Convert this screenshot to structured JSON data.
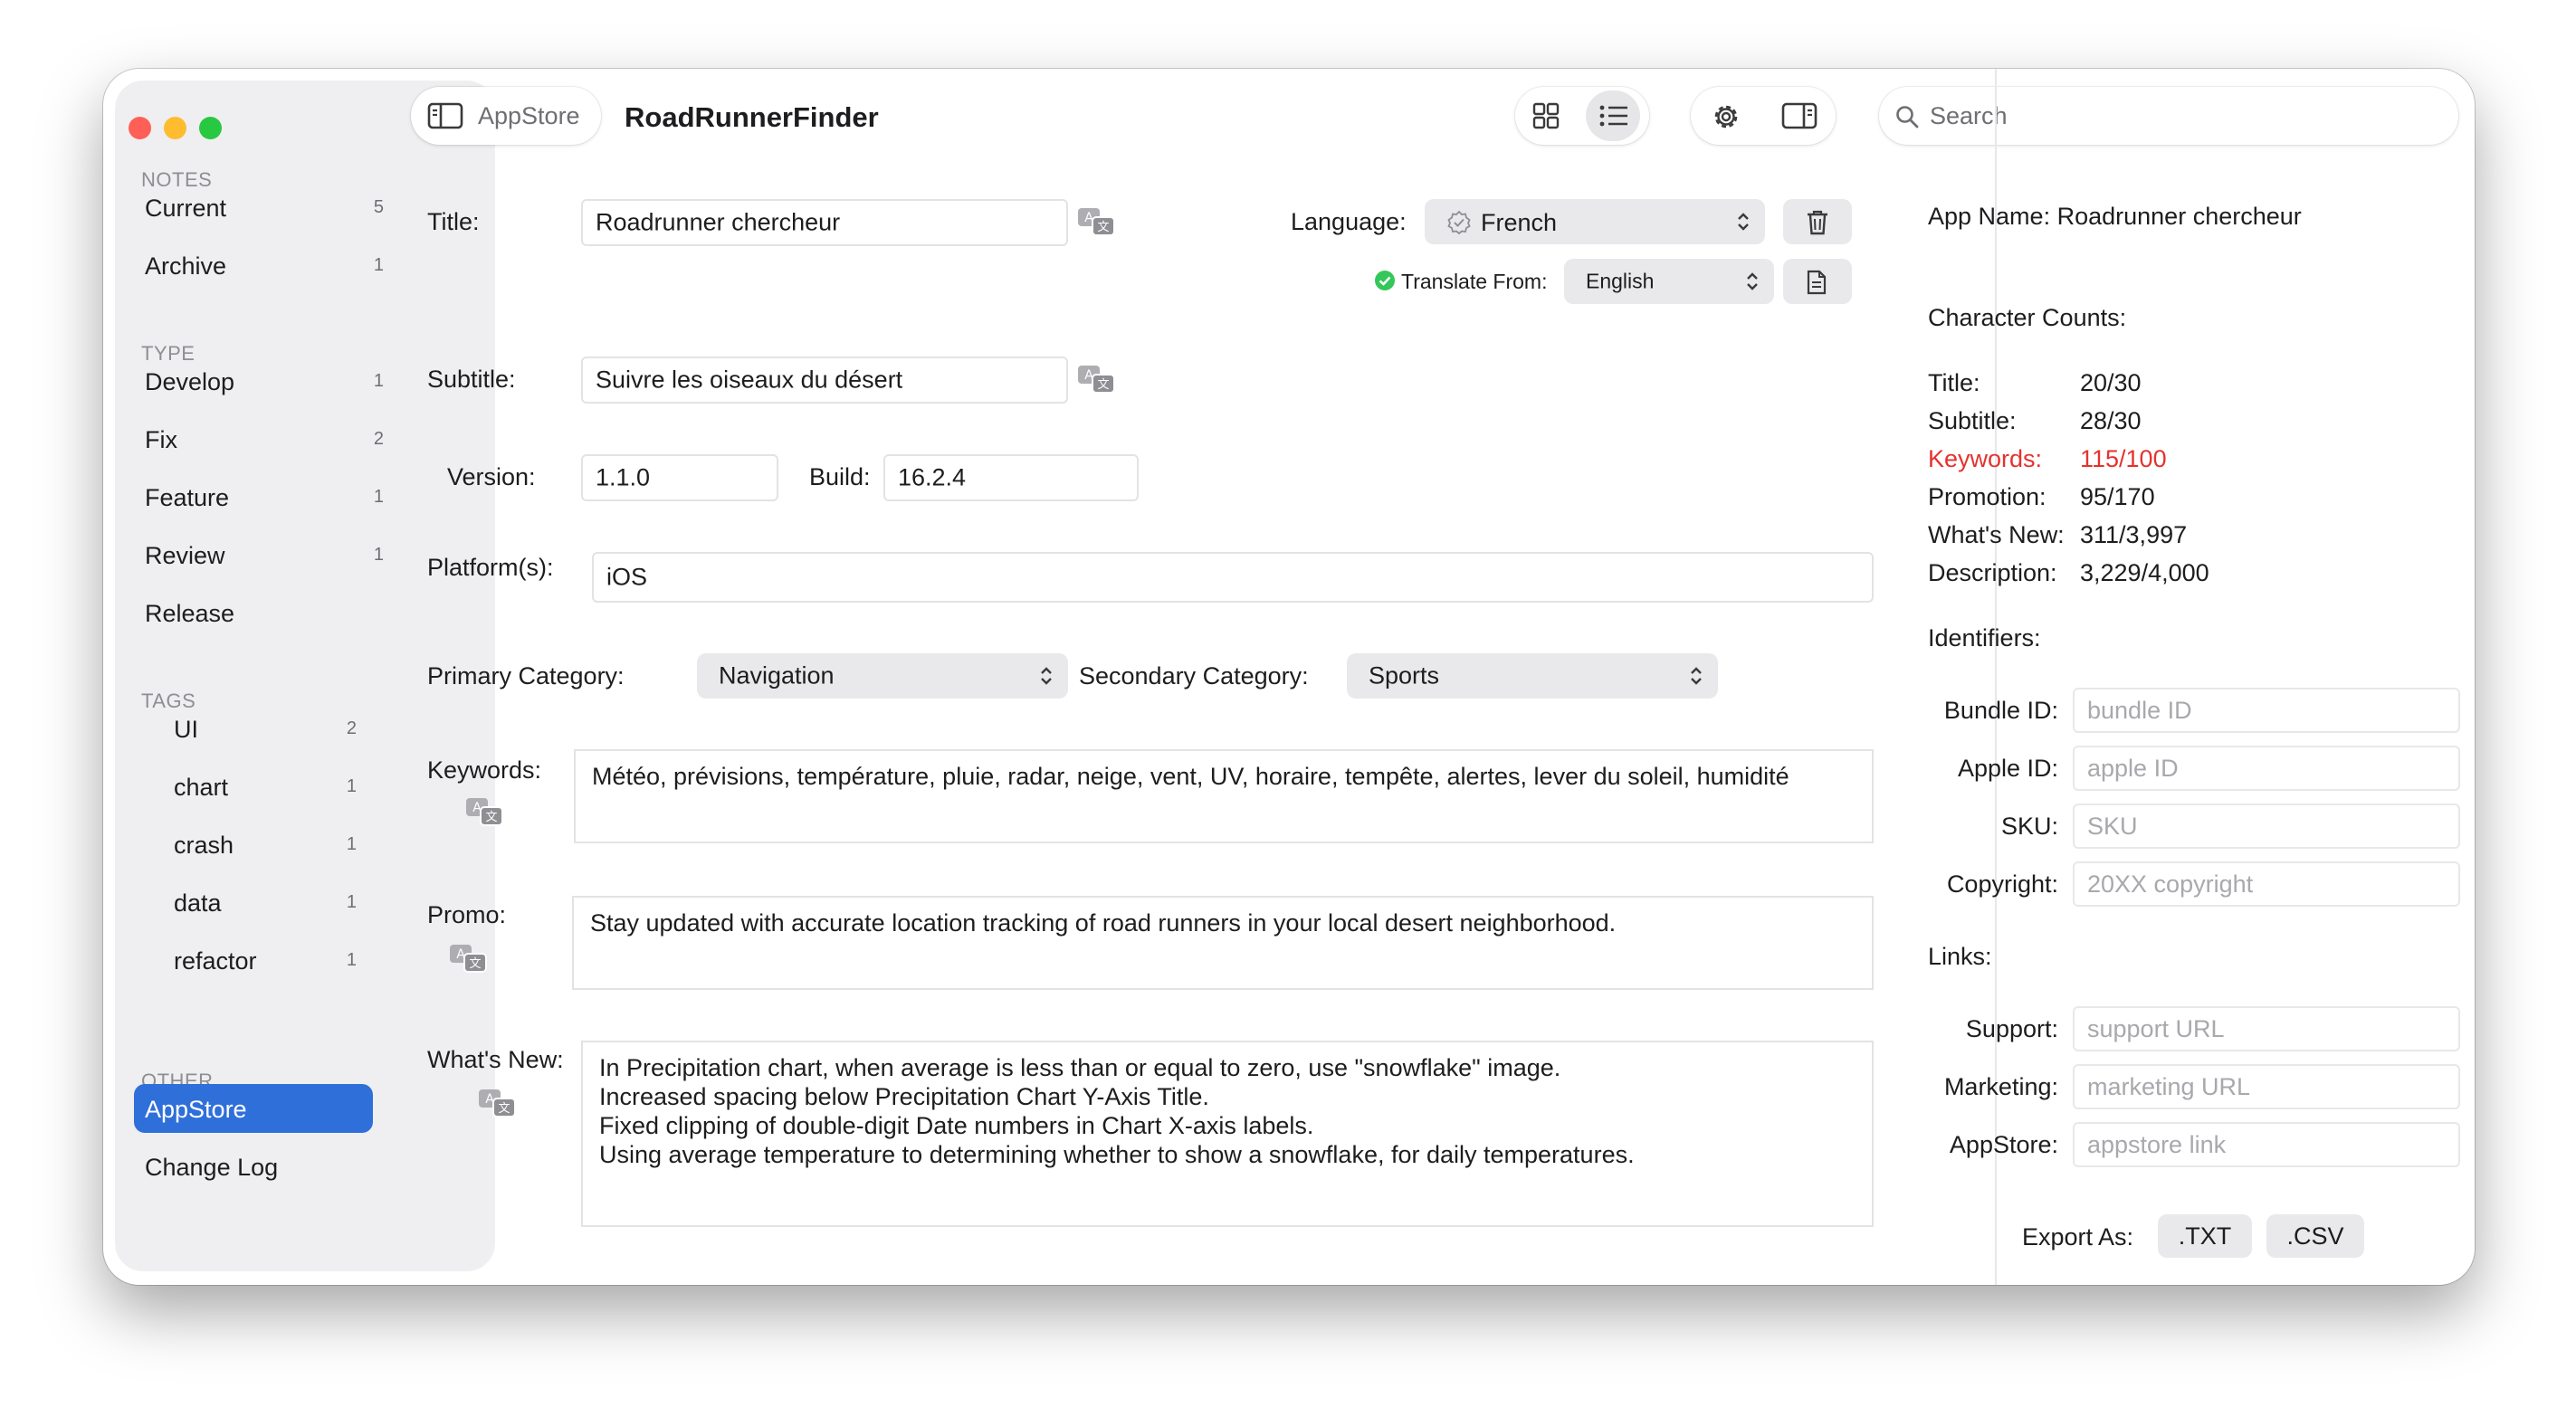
{
  "sidebar": {
    "sections": [
      {
        "header": "NOTES",
        "items": [
          {
            "label": "Current",
            "count": "5"
          },
          {
            "label": "Archive",
            "count": "1"
          }
        ]
      },
      {
        "header": "TYPE",
        "items": [
          {
            "label": "Develop",
            "count": "1"
          },
          {
            "label": "Fix",
            "count": "2"
          },
          {
            "label": "Feature",
            "count": "1"
          },
          {
            "label": "Review",
            "count": "1"
          },
          {
            "label": "Release",
            "count": ""
          }
        ]
      },
      {
        "header": "TAGS",
        "items": [
          {
            "label": "UI",
            "count": "2"
          },
          {
            "label": "chart",
            "count": "1"
          },
          {
            "label": "crash",
            "count": "1"
          },
          {
            "label": "data",
            "count": "1"
          },
          {
            "label": "refactor",
            "count": "1"
          }
        ]
      },
      {
        "header": "OTHER",
        "items": [
          {
            "label": "AppStore",
            "count": ""
          },
          {
            "label": "Change Log",
            "count": ""
          }
        ]
      }
    ],
    "active_item": "AppStore"
  },
  "toolbar": {
    "sidebar_toggle_label": "AppStore",
    "window_title": "RoadRunnerFinder",
    "search_placeholder": "Search"
  },
  "form": {
    "title_label": "Title:",
    "title_value": "Roadrunner chercheur",
    "language_label": "Language:",
    "language_value": "French",
    "translate_from_label": "Translate From:",
    "translate_from_value": "English",
    "subtitle_label": "Subtitle:",
    "subtitle_value": "Suivre les oiseaux du désert",
    "version_label": "Version:",
    "version_value": "1.1.0",
    "build_label": "Build:",
    "build_value": "16.2.4",
    "platforms_label": "Platform(s):",
    "platforms_value": "iOS",
    "primary_category_label": "Primary Category:",
    "primary_category_value": "Navigation",
    "secondary_category_label": "Secondary Category:",
    "secondary_category_value": "Sports",
    "keywords_label": "Keywords:",
    "keywords_value": "Météo, prévisions, température, pluie, radar, neige, vent, UV, horaire, tempête, alertes, lever du soleil, humidité",
    "promo_label": "Promo:",
    "promo_value": "Stay updated with accurate location tracking of road runners in your local desert neighborhood.",
    "whats_new_label": "What's New:",
    "whats_new_value": "In Precipitation chart, when average is less than or equal to zero, use \"snowflake\" image.\nIncreased spacing below Precipitation Chart Y-Axis Title.\nFixed clipping of double-digit Date numbers in Chart X-axis labels.\nUsing average temperature to determining whether to show a snowflake, for daily temperatures."
  },
  "inspector": {
    "app_name_label": "App Name:",
    "app_name_value": "Roadrunner chercheur",
    "character_counts_header": "Character Counts:",
    "counts": [
      {
        "label": "Title:",
        "value": "20/30",
        "over": false
      },
      {
        "label": "Subtitle:",
        "value": "28/30",
        "over": false
      },
      {
        "label": "Keywords:",
        "value": "115/100",
        "over": true
      },
      {
        "label": "Promotion:",
        "value": "95/170",
        "over": false
      },
      {
        "label": "What's New:",
        "value": "311/3,997",
        "over": false
      },
      {
        "label": "Description:",
        "value": "3,229/4,000",
        "over": false
      }
    ],
    "identifiers_header": "Identifiers:",
    "identifiers": [
      {
        "label": "Bundle ID:",
        "placeholder": "bundle ID"
      },
      {
        "label": "Apple ID:",
        "placeholder": "apple ID"
      },
      {
        "label": "SKU:",
        "placeholder": "SKU"
      },
      {
        "label": "Copyright:",
        "placeholder": "20XX copyright"
      }
    ],
    "links_header": "Links:",
    "links": [
      {
        "label": "Support:",
        "placeholder": "support URL"
      },
      {
        "label": "Marketing:",
        "placeholder": "marketing URL"
      },
      {
        "label": "AppStore:",
        "placeholder": "appstore link"
      }
    ],
    "export_label": "Export As:",
    "export_txt": ".TXT",
    "export_csv": ".CSV"
  },
  "colors": {
    "accent": "#2f6fd9",
    "over_limit": "#e5322d",
    "close": "#ff5f57",
    "minimize": "#febc2e",
    "zoom": "#28c840",
    "translate_ok": "#34c759"
  }
}
